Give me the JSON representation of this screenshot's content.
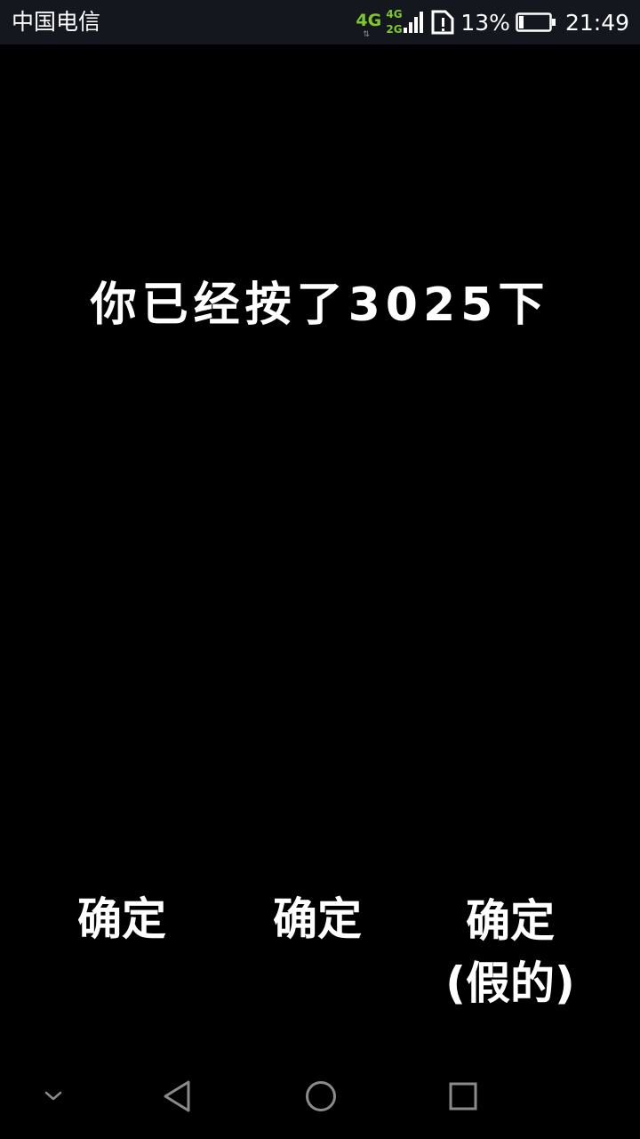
{
  "status_bar": {
    "carrier": "中国电信",
    "network_primary": "4G",
    "network_secondary_top": "4G",
    "network_secondary_bottom": "2G",
    "battery_percent": "13%",
    "time": "21:49",
    "accent_color": "#7ec82a"
  },
  "main": {
    "counter_text": "你已经按了3025下"
  },
  "buttons": {
    "confirm_1": "确定",
    "confirm_2": "确定",
    "confirm_3_line1": "确定",
    "confirm_3_line2": "(假的)"
  },
  "nav_bar": {
    "icons": [
      "chevron-down-icon",
      "back-icon",
      "home-icon",
      "recents-icon"
    ]
  }
}
